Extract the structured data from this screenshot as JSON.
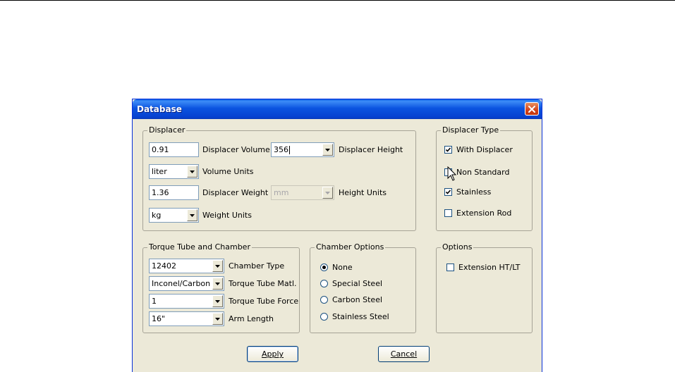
{
  "window": {
    "title": "Database"
  },
  "displacer": {
    "legend": "Displacer",
    "volume_value": "0.91",
    "volume_label": "Displacer Volume",
    "height_value": "356",
    "height_label": "Displacer Height",
    "volume_units_value": "liter",
    "volume_units_label": "Volume Units",
    "weight_value": "1.36",
    "weight_label": "Displacer Weight",
    "height_units_value": "mm",
    "height_units_label": "Height Units",
    "weight_units_value": "kg",
    "weight_units_label": "Weight Units"
  },
  "displacer_type": {
    "legend": "Displacer Type",
    "options": [
      {
        "label": "With Displacer",
        "checked": true
      },
      {
        "label": "Non Standard",
        "checked": false
      },
      {
        "label": "Stainless",
        "checked": true
      },
      {
        "label": "Extension Rod",
        "checked": false
      }
    ]
  },
  "torque": {
    "legend": "Torque Tube and Chamber",
    "chamber_type_value": "12402",
    "chamber_type_label": "Chamber Type",
    "matl_value": "Inconel/Carbon",
    "matl_label": "Torque Tube Matl.",
    "force_value": "1",
    "force_label": "Torque Tube Force",
    "arm_value": "16\"",
    "arm_label": "Arm Length"
  },
  "chamber_options": {
    "legend": "Chamber Options",
    "options": [
      {
        "label": "None",
        "selected": true
      },
      {
        "label": "Special Steel",
        "selected": false
      },
      {
        "label": "Carbon Steel",
        "selected": false
      },
      {
        "label": "Stainless Steel",
        "selected": false
      }
    ]
  },
  "options": {
    "legend": "Options",
    "extension_label": "Extension HT/LT",
    "extension_checked": false
  },
  "buttons": {
    "apply": "Apply",
    "cancel": "Cancel"
  },
  "colors": {
    "titlebar": "#0a5fe6",
    "dialog_bg": "#ece9d8",
    "close_button": "#d3421a"
  }
}
